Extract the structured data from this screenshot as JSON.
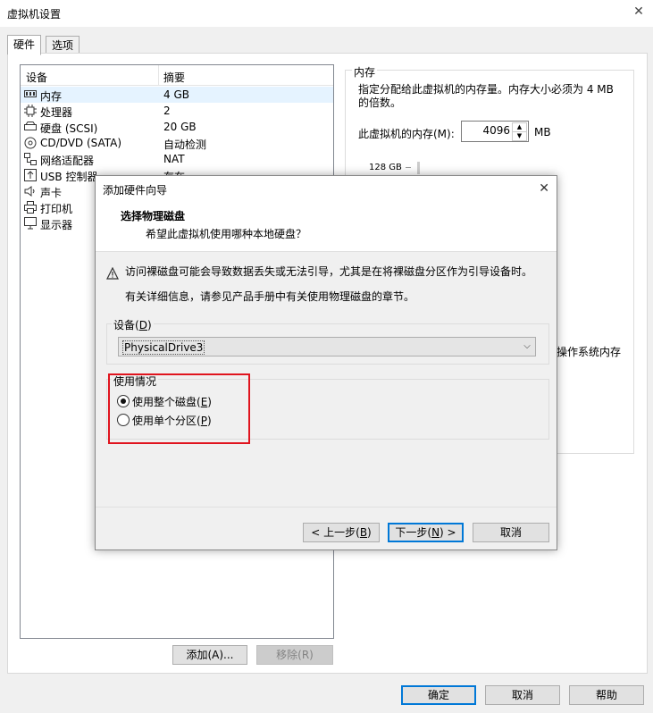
{
  "window": {
    "title": "虚拟机设置"
  },
  "tabs": [
    {
      "label": "硬件"
    },
    {
      "label": "选项"
    }
  ],
  "device_list": {
    "col_device": "设备",
    "col_summary": "摘要",
    "rows": [
      {
        "name": "内存",
        "summary": "4 GB",
        "icon": "memory-icon"
      },
      {
        "name": "处理器",
        "summary": "2",
        "icon": "cpu-icon"
      },
      {
        "name": "硬盘 (SCSI)",
        "summary": "20 GB",
        "icon": "harddisk-icon"
      },
      {
        "name": "CD/DVD (SATA)",
        "summary": "自动检测",
        "icon": "cd-icon"
      },
      {
        "name": "网络适配器",
        "summary": "NAT",
        "icon": "network-icon"
      },
      {
        "name": "USB 控制器",
        "summary": "存在",
        "icon": "usb-icon"
      },
      {
        "name": "声卡",
        "summary": "",
        "icon": "speaker-icon"
      },
      {
        "name": "打印机",
        "summary": "",
        "icon": "printer-icon"
      },
      {
        "name": "显示器",
        "summary": "",
        "icon": "monitor-icon"
      }
    ]
  },
  "memory_panel": {
    "group_label": "内存",
    "description": "指定分配给此虚拟机的内存量。内存大小必须为 4 MB 的倍数。",
    "field_label": "此虚拟机的内存(M):",
    "value": "4096",
    "unit": "MB",
    "max_label": "128 GB",
    "partial_text": "操作系统内存"
  },
  "list_buttons": {
    "add": "添加(A)...",
    "remove": "移除(R)"
  },
  "footer_buttons": {
    "ok": "确定",
    "cancel": "取消",
    "help": "帮助"
  },
  "dialog": {
    "title": "添加硬件向导",
    "heading": "选择物理磁盘",
    "subheading": "希望此虚拟机使用哪种本地硬盘？",
    "warning": "访问裸磁盘可能会导致数据丢失或无法引导，尤其是在将裸磁盘分区作为引导设备时。",
    "info": "有关详细信息，请参见产品手册中有关使用物理磁盘的章节。",
    "device_label_pre": "设备(",
    "device_label_key": "D",
    "device_label_post": ")",
    "device_value": "PhysicalDrive3",
    "usage_label": "使用情况",
    "opt_whole_pre": "使用整个磁盘(",
    "opt_whole_key": "E",
    "opt_single_pre": "使用单个分区(",
    "opt_single_key": "P",
    "close_paren": ")",
    "back_pre": "< 上一步(",
    "back_key": "B",
    "next_pre": "下一步(",
    "next_key": "N",
    "next_post": ") >",
    "cancel": "取消",
    "selected_option": "whole"
  }
}
